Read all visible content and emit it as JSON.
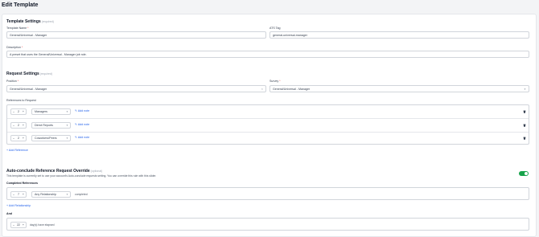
{
  "page": {
    "title": "Edit Template"
  },
  "template_settings": {
    "title": "Template Settings",
    "required_tag": "(required)",
    "name_label": "Template Name",
    "name_value": "General/Universal - Manager",
    "ats_label": "ATS Tag",
    "ats_value": "general-universal-manager",
    "description_label": "Description",
    "description_value": "A preset that uses the General/Universal - Manager job role."
  },
  "request_settings": {
    "title": "Request Settings",
    "required_tag": "(required)",
    "position_label": "Position",
    "position_value": "General/Universal - Manager",
    "survey_label": "Survey",
    "survey_value": "General/Universal - Manager",
    "references_label": "References to Request",
    "references": [
      {
        "count": "2",
        "type": "Managers",
        "note_label": "Add note"
      },
      {
        "count": "2",
        "type": "Direct Reports",
        "note_label": "Add note"
      },
      {
        "count": "2",
        "type": "Coworkers/Peers",
        "note_label": "Add note"
      }
    ],
    "add_reference_label": "Add Reference"
  },
  "auto_conclude": {
    "title": "Auto-conclude Reference Request Override",
    "optional_tag": "(optional)",
    "description": "This template is currently set to use your account's Auto-conclude requests setting. You can override this rule with this slider.",
    "toggle_on": true,
    "completed_label": "Completed References",
    "completed_count": "7",
    "relationship_value": "Any Relationship",
    "completed_suffix": "completed",
    "add_relationship_label": "Add Relationship",
    "and_label": "And",
    "days_count": "22",
    "days_suffix": "day(s) have elapsed"
  },
  "colors": {
    "accent": "#2563eb",
    "toggle": "#16a34a",
    "required": "#ef4444"
  }
}
